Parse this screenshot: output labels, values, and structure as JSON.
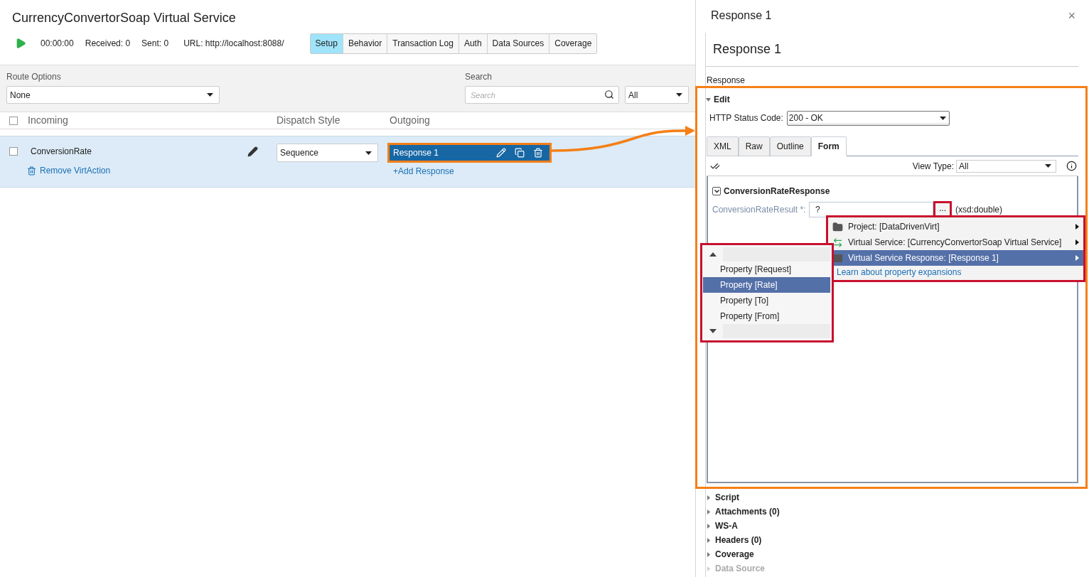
{
  "window": {
    "title": "CurrencyConvertorSoap Virtual Service"
  },
  "toolbar": {
    "timer": "00:00:00",
    "received": "Received: 0",
    "sent": "Sent: 0",
    "url": "URL: http://localhost:8088/"
  },
  "tabs": [
    {
      "label": "Setup",
      "selected": true
    },
    {
      "label": "Behavior",
      "selected": false
    },
    {
      "label": "Transaction Log",
      "selected": false
    },
    {
      "label": "Auth",
      "selected": false
    },
    {
      "label": "Data Sources",
      "selected": false
    },
    {
      "label": "Coverage",
      "selected": false
    }
  ],
  "route_options": {
    "label": "Route Options",
    "value": "None"
  },
  "search": {
    "label": "Search",
    "placeholder": "Search",
    "filter": "All"
  },
  "table": {
    "columns": [
      "Incoming",
      "Dispatch Style",
      "Outgoing"
    ],
    "all_checked": false,
    "rows": [
      {
        "checked": false,
        "incoming": "ConversionRate",
        "remove": "Remove VirtAction",
        "dispatch": "Sequence",
        "responses": [
          {
            "label": "Response 1",
            "selected": true
          }
        ],
        "add": "+Add Response"
      }
    ]
  },
  "editor": {
    "tab_title": "Response 1",
    "close": "×",
    "title": "Response 1",
    "section_label": "Response",
    "edit_label": "Edit",
    "edit_expanded": true,
    "status_label": "HTTP Status Code:",
    "status_value": "200 - OK",
    "tabs": [
      {
        "label": "XML",
        "selected": false
      },
      {
        "label": "Raw",
        "selected": false
      },
      {
        "label": "Outline",
        "selected": false
      },
      {
        "label": "Form",
        "selected": true
      }
    ],
    "view_type_label": "View Type:",
    "view_type": "All",
    "element": {
      "name": "ConversionRateResponse",
      "expanded": true
    },
    "field": {
      "label": "ConversionRateResult *:",
      "value": "?",
      "button": "...",
      "type": "(xsd:double)"
    }
  },
  "expansion_menu": {
    "items": [
      {
        "kind": "folder",
        "label": "Project: [DataDrivenVirt]",
        "selected": false
      },
      {
        "kind": "service",
        "label": "Virtual Service: [CurrencyConvertorSoap Virtual Service]",
        "selected": false
      },
      {
        "kind": "response",
        "label": "Virtual Service Response: [Response 1]",
        "selected": true
      }
    ],
    "link": "Learn about property expansions"
  },
  "property_menu": {
    "items": [
      {
        "label": "Property [Request]",
        "selected": false
      },
      {
        "label": "Property [Rate]",
        "selected": true
      },
      {
        "label": "Property [To]",
        "selected": false
      },
      {
        "label": "Property [From]",
        "selected": false
      }
    ]
  },
  "sections": [
    {
      "label": "Script",
      "disabled": false
    },
    {
      "label": "Attachments (0)",
      "disabled": false
    },
    {
      "label": "WS-A",
      "disabled": false
    },
    {
      "label": "Headers (0)",
      "disabled": false
    },
    {
      "label": "Coverage",
      "disabled": false
    },
    {
      "label": "Data Source",
      "disabled": true
    }
  ]
}
